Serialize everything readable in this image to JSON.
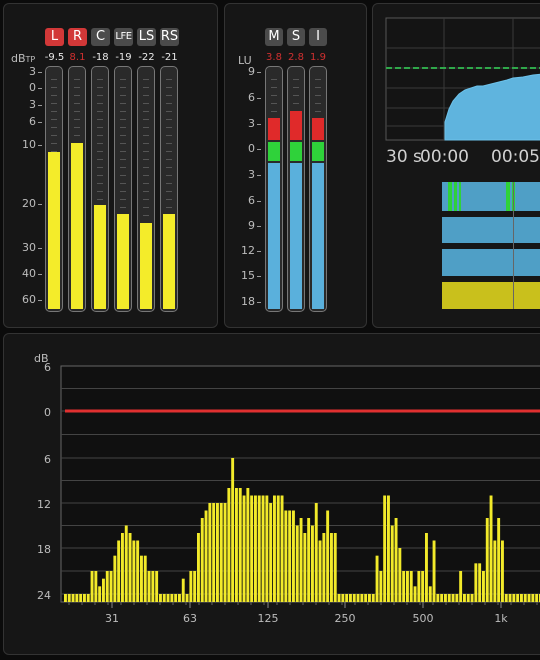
{
  "true_peak": {
    "unit": "dB",
    "unit_sub": "TP",
    "channels": [
      {
        "label": "L",
        "peak": "-9.5",
        "peak_color": "#e8e8e8",
        "level": -11,
        "style": "red"
      },
      {
        "label": "R",
        "peak": "8.1",
        "peak_color": "#d03030",
        "level": -9.5,
        "style": "red"
      },
      {
        "label": "C",
        "peak": "-18",
        "peak_color": "#e8e8e8",
        "level": -20,
        "style": "grey"
      },
      {
        "label": "LFE",
        "peak": "-19",
        "peak_color": "#e8e8e8",
        "level": -22,
        "style": "grey"
      },
      {
        "label": "LS",
        "peak": "-22",
        "peak_color": "#e8e8e8",
        "level": -24,
        "style": "grey"
      },
      {
        "label": "RS",
        "peak": "-21",
        "peak_color": "#e8e8e8",
        "level": -22,
        "style": "grey"
      }
    ],
    "scale": [
      "3",
      "0",
      "3",
      "6",
      "10",
      "20",
      "30",
      "40",
      "60"
    ]
  },
  "loudness": {
    "unit": "LU",
    "channels": [
      {
        "label": "M",
        "peak": "3.8",
        "level": 3.8
      },
      {
        "label": "S",
        "peak": "2.8",
        "level": 4.6
      },
      {
        "label": "I",
        "peak": "1.9",
        "level": 3.8
      }
    ],
    "peak_color": "#d03030",
    "scale": [
      "9",
      "6",
      "3",
      "0",
      "3",
      "6",
      "9",
      "12",
      "15",
      "18"
    ]
  },
  "history": {
    "time_labels": [
      "30 s",
      "00:00",
      "00:05"
    ],
    "bars": [
      "cyan",
      "cyan",
      "cyan",
      "yellow"
    ]
  },
  "spectrum": {
    "unit": "dB",
    "y_labels": [
      "6",
      "0",
      "6",
      "12",
      "18",
      "24"
    ],
    "x_labels": [
      "31",
      "63",
      "125",
      "250",
      "500",
      "1k"
    ],
    "ref_line_color": "#e03030",
    "bar_color": "#f2ea2a",
    "bands_db": [
      -24,
      -24,
      -24,
      -24,
      -24,
      -24,
      -24,
      -21,
      -21,
      -23,
      -22,
      -21,
      -21,
      -19,
      -17,
      -16,
      -15,
      -16,
      -17,
      -17,
      -19,
      -19,
      -21,
      -21,
      -21,
      -24,
      -24,
      -24,
      -24,
      -24,
      -24,
      -22,
      -24,
      -21,
      -21,
      -16,
      -14,
      -13,
      -12,
      -12,
      -12,
      -12,
      -12,
      -10,
      -6,
      -10,
      -10,
      -11,
      -10,
      -11,
      -11,
      -11,
      -11,
      -11,
      -12,
      -11,
      -11,
      -11,
      -13,
      -13,
      -13,
      -15,
      -14,
      -16,
      -14,
      -15,
      -12,
      -17,
      -16,
      -13,
      -16,
      -16,
      -24,
      -24,
      -24,
      -24,
      -24,
      -24,
      -24,
      -24,
      -24,
      -24,
      -19,
      -21,
      -11,
      -11,
      -15,
      -14,
      -18,
      -21,
      -21,
      -21,
      -23,
      -21,
      -21,
      -16,
      -23,
      -17,
      -24,
      -24,
      -24,
      -24,
      -24,
      -24,
      -21,
      -24,
      -24,
      -24,
      -20,
      -20,
      -21,
      -14,
      -11,
      -17,
      -14,
      -17,
      -24,
      -24,
      -24,
      -24,
      -24,
      -24,
      -24,
      -24,
      -24,
      -24,
      -20,
      -18,
      -19,
      -18,
      -21,
      -19,
      -7,
      -15,
      -17,
      -17,
      -20,
      -19,
      -19,
      -20,
      -17,
      -19,
      -24,
      -24,
      -24,
      -24,
      -24,
      -18,
      -17,
      -18,
      -24,
      -24
    ]
  }
}
